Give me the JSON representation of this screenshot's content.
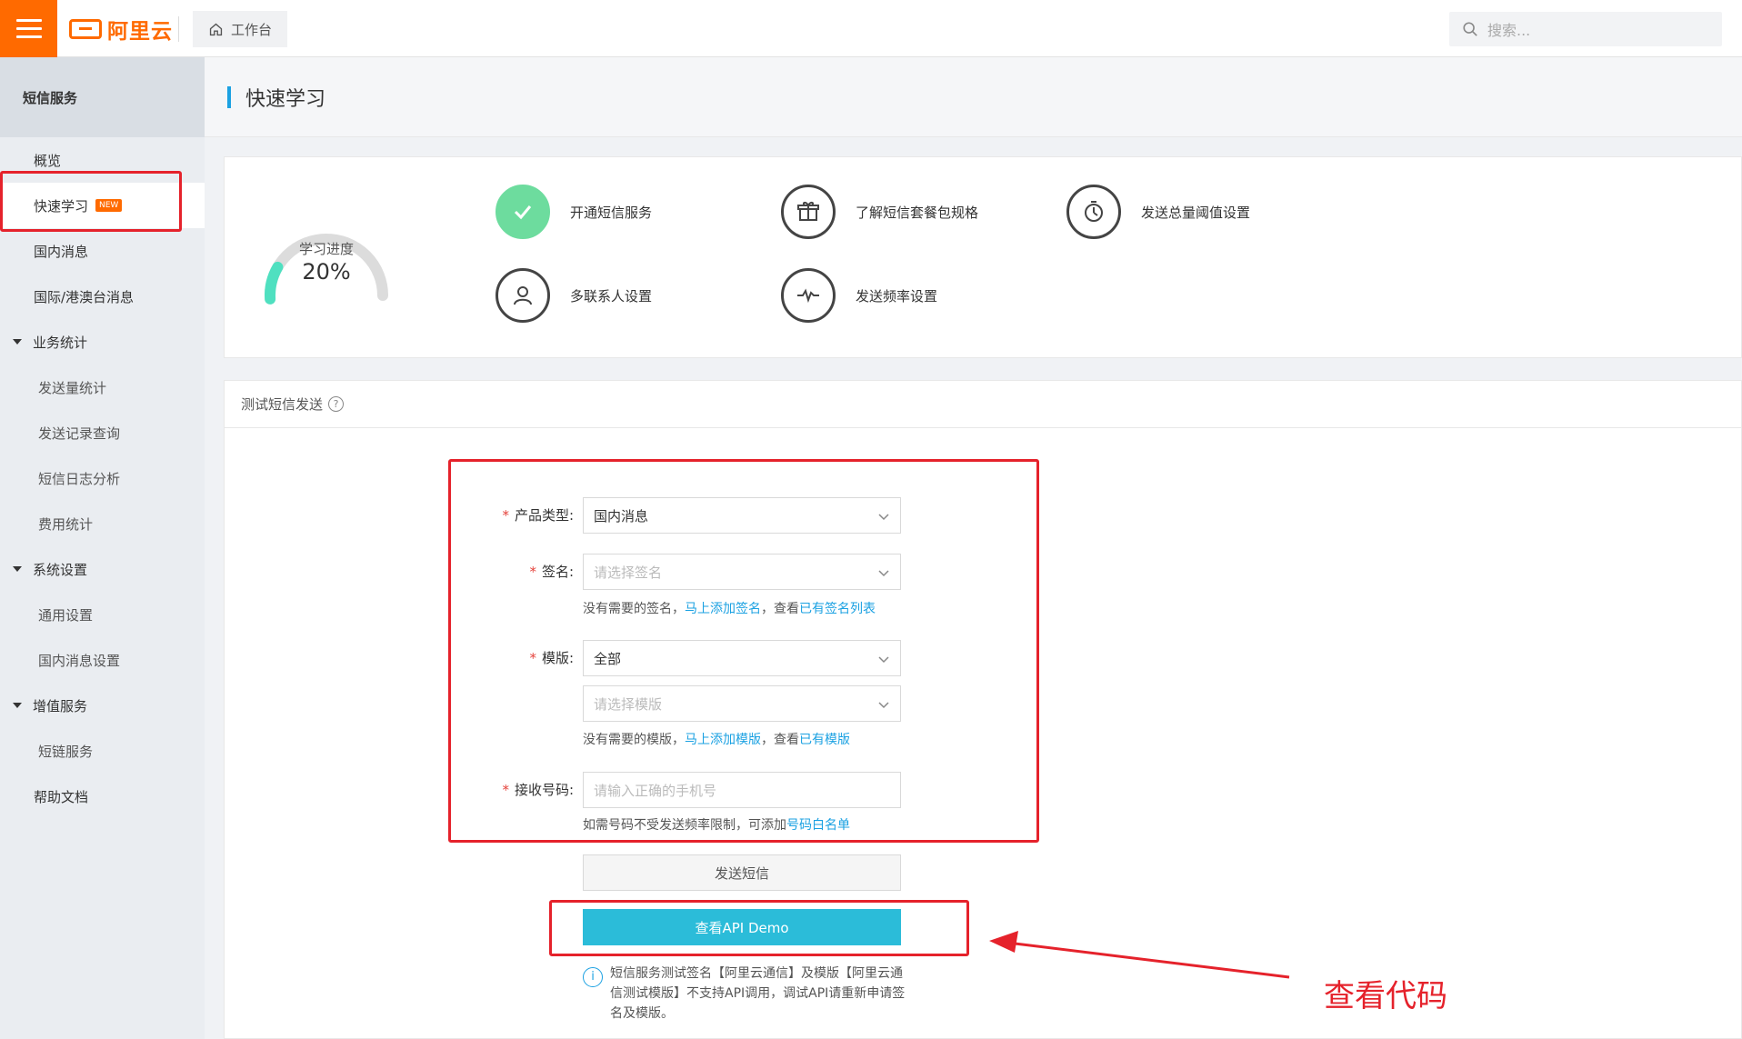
{
  "topbar": {
    "logo_text": "阿里云",
    "workbench_label": "工作台",
    "search_placeholder": "搜索..."
  },
  "sidebar": {
    "header": "短信服务",
    "items": [
      {
        "label": "概览"
      },
      {
        "label": "快速学习",
        "badge": "NEW"
      },
      {
        "label": "国内消息"
      },
      {
        "label": "国际/港澳台消息"
      },
      {
        "label": "业务统计"
      },
      {
        "label": "发送量统计"
      },
      {
        "label": "发送记录查询"
      },
      {
        "label": "短信日志分析"
      },
      {
        "label": "费用统计"
      },
      {
        "label": "系统设置"
      },
      {
        "label": "通用设置"
      },
      {
        "label": "国内消息设置"
      },
      {
        "label": "增值服务"
      },
      {
        "label": "短链服务"
      },
      {
        "label": "帮助文档"
      }
    ]
  },
  "page": {
    "title": "快速学习"
  },
  "progress": {
    "label": "学习进度",
    "value_text": "20%",
    "value": 0.2
  },
  "steps": [
    {
      "label": "开通短信服务",
      "icon": "check-icon",
      "done": true
    },
    {
      "label": "了解短信套餐包规格",
      "icon": "gift-icon"
    },
    {
      "label": "发送总量阈值设置",
      "icon": "timer-icon"
    },
    {
      "label": "多联系人设置",
      "icon": "user-icon"
    },
    {
      "label": "发送频率设置",
      "icon": "pulse-icon"
    }
  ],
  "test_section": {
    "title": "测试短信发送",
    "form": {
      "product_type": {
        "label": "产品类型:",
        "value": "国内消息"
      },
      "signature": {
        "label": "签名:",
        "placeholder": "请选择签名",
        "help_prefix": "没有需要的签名，",
        "help_link1": "马上添加签名",
        "help_mid": "，查看",
        "help_link2": "已有签名列表"
      },
      "template": {
        "label": "模版:",
        "category_value": "全部",
        "placeholder": "请选择模版",
        "help_prefix": "没有需要的模版，",
        "help_link1": "马上添加模版",
        "help_mid": "，查看",
        "help_link2": "已有模版"
      },
      "phone": {
        "label": "接收号码:",
        "placeholder": "请输入正确的手机号",
        "help_prefix": "如需号码不受发送频率限制，可添加",
        "help_link": "号码白名单"
      }
    },
    "send_button": "发送短信",
    "demo_button": "查看API Demo",
    "notice": "短信服务测试签名【阿里云通信】及模版【阿里云通信测试模版】不支持API调用，调试API请重新申请签名及模版。"
  },
  "annotation": {
    "text": "查看代码",
    "color": "#e5222b"
  }
}
